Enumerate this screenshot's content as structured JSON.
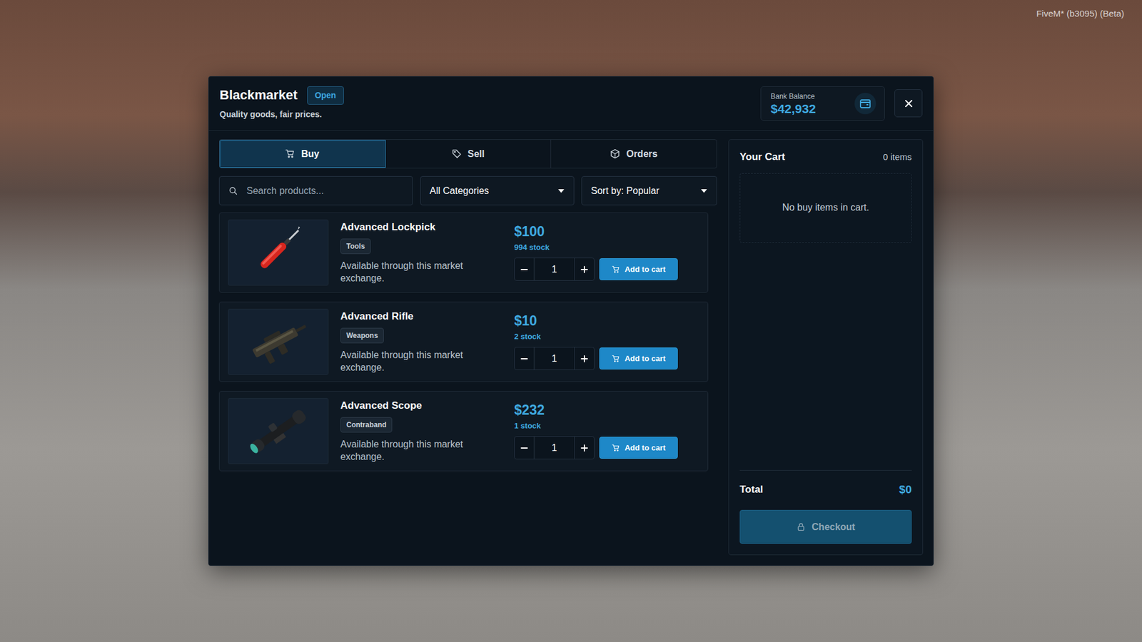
{
  "watermark": "FiveM* (b3095) (Beta)",
  "header": {
    "title": "Blackmarket",
    "status": "Open",
    "subtitle": "Quality goods, fair prices.",
    "balance_label": "Bank Balance",
    "balance": "$42,932"
  },
  "tabs": [
    {
      "label": "Buy",
      "selected": true
    },
    {
      "label": "Sell",
      "selected": false
    },
    {
      "label": "Orders",
      "selected": false
    }
  ],
  "search": {
    "placeholder": "Search products..."
  },
  "filters": {
    "category": "All Categories",
    "sort": "Sort by: Popular"
  },
  "products": [
    {
      "name": "Advanced Lockpick",
      "category": "Tools",
      "description": "Available through this market exchange.",
      "price": "$100",
      "stock": "994 stock",
      "quantity": "1",
      "button": "Add to cart"
    },
    {
      "name": "Advanced Rifle",
      "category": "Weapons",
      "description": "Available through this market exchange.",
      "price": "$10",
      "stock": "2 stock",
      "quantity": "1",
      "button": "Add to cart"
    },
    {
      "name": "Advanced Scope",
      "category": "Contraband",
      "description": "Available through this market exchange.",
      "price": "$232",
      "stock": "1 stock",
      "quantity": "1",
      "button": "Add to cart"
    }
  ],
  "cart": {
    "title": "Your Cart",
    "count": "0 items",
    "empty": "No buy items in cart.",
    "total_label": "Total",
    "total": "$0",
    "checkout": "Checkout",
    "checkout_disabled": true
  }
}
